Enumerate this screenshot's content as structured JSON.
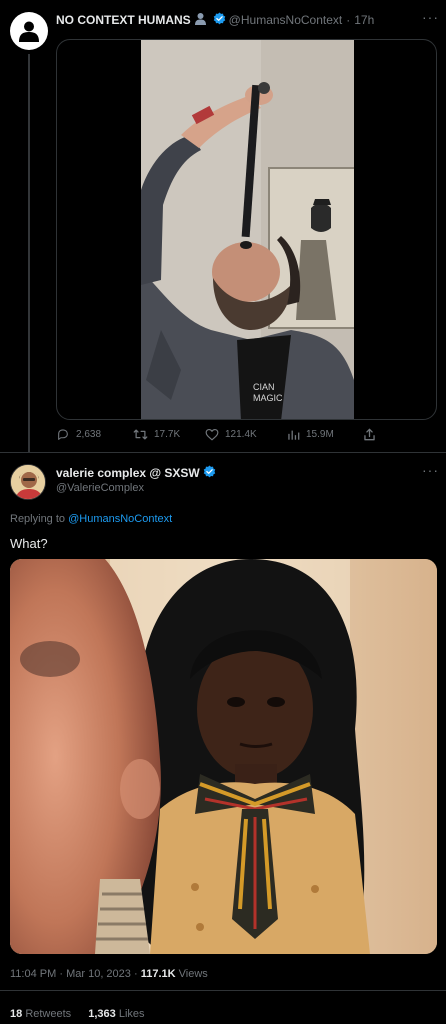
{
  "tweet1": {
    "display_name": "NO CONTEXT HUMANS",
    "handle": "@HumansNoContext",
    "separator": "·",
    "time": "17h",
    "more": "···",
    "video_overlay_text": "CIAN\nMAGIC",
    "actions": {
      "replies": "2,638",
      "retweets": "17.7K",
      "likes": "121.4K",
      "views": "15.9M"
    }
  },
  "tweet2": {
    "display_name": "valerie complex @ SXSW",
    "handle": "@ValerieComplex",
    "more": "···",
    "replying_prefix": "Replying to",
    "replying_to": "@HumansNoContext",
    "text": "What?",
    "time": "11:04 PM",
    "date": "Mar 10, 2023",
    "dot": "·",
    "views_count": "117.1K",
    "views_label": "Views",
    "retweets_count": "18",
    "retweets_label": "Retweets",
    "likes_count": "1,363",
    "likes_label": "Likes"
  },
  "colors": {
    "background": "#000000",
    "verified": "#1d9bf0",
    "muted": "#71767b",
    "text": "#e7e9ea",
    "divider": "#2f3336"
  },
  "icons": [
    "default-avatar-icon",
    "silhouette-emoji-icon",
    "verified-badge-icon",
    "reply-icon",
    "retweet-icon",
    "like-icon",
    "views-icon",
    "share-icon",
    "more-icon"
  ]
}
